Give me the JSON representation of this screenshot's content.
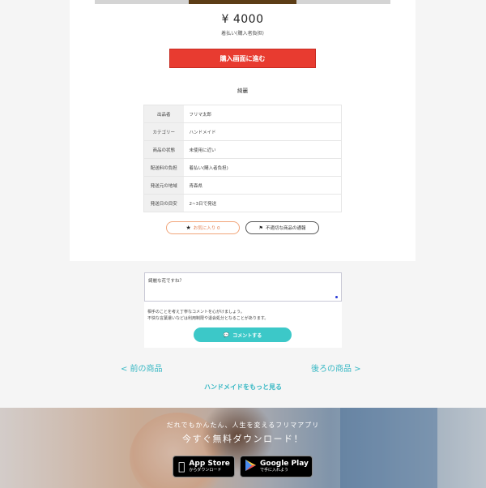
{
  "item": {
    "price": "¥ 4000",
    "shipping_note": "着払い(購入者負担)",
    "buy_label": "購入画面に進む",
    "description": "綺麗"
  },
  "details": [
    {
      "label": "出品者",
      "value": "フリマ太郎"
    },
    {
      "label": "カテゴリー",
      "value": "ハンドメイド"
    },
    {
      "label": "商品の状態",
      "value": "未使用に近い"
    },
    {
      "label": "配送料の負担",
      "value": "着払い(購入者負担)"
    },
    {
      "label": "発送元の地域",
      "value": "青森県"
    },
    {
      "label": "発送日の目安",
      "value": "2~3日で発送"
    }
  ],
  "actions": {
    "favorite_label": "お気に入り 0",
    "report_label": "不適切な商品の通報"
  },
  "comment": {
    "input_value": "綺麗な花ですね？",
    "note_line1": "相手のことを考え丁寧なコメントを心がけましょう。",
    "note_line2": "不快な言葉遣いなどは利用制限や退会処分となることがあります。",
    "submit_label": "コメントする"
  },
  "nav": {
    "prev_label": "< 前の商品",
    "next_label": "後ろの商品 >",
    "more_label": "ハンドメイドをもっと見る"
  },
  "banner": {
    "tagline": "だれでもかんたん、人生を変えるフリマアプリ",
    "title": "今すぐ無料ダウンロード！",
    "app_store_small": "からダウンロード",
    "app_store_big": "App Store",
    "google_play_big": "Google Play",
    "google_play_small": "で手に入れよう"
  },
  "colors": {
    "buy_button": "#e83b30",
    "comment_button": "#3cc8c8",
    "link": "#38b8c4",
    "favorite_border": "#f1a57a"
  },
  "icons": {
    "favorite": "star-icon",
    "report": "flag-icon",
    "comment": "speech-bubble-icon",
    "app_store": "apple-icon",
    "google_play": "play-icon"
  }
}
